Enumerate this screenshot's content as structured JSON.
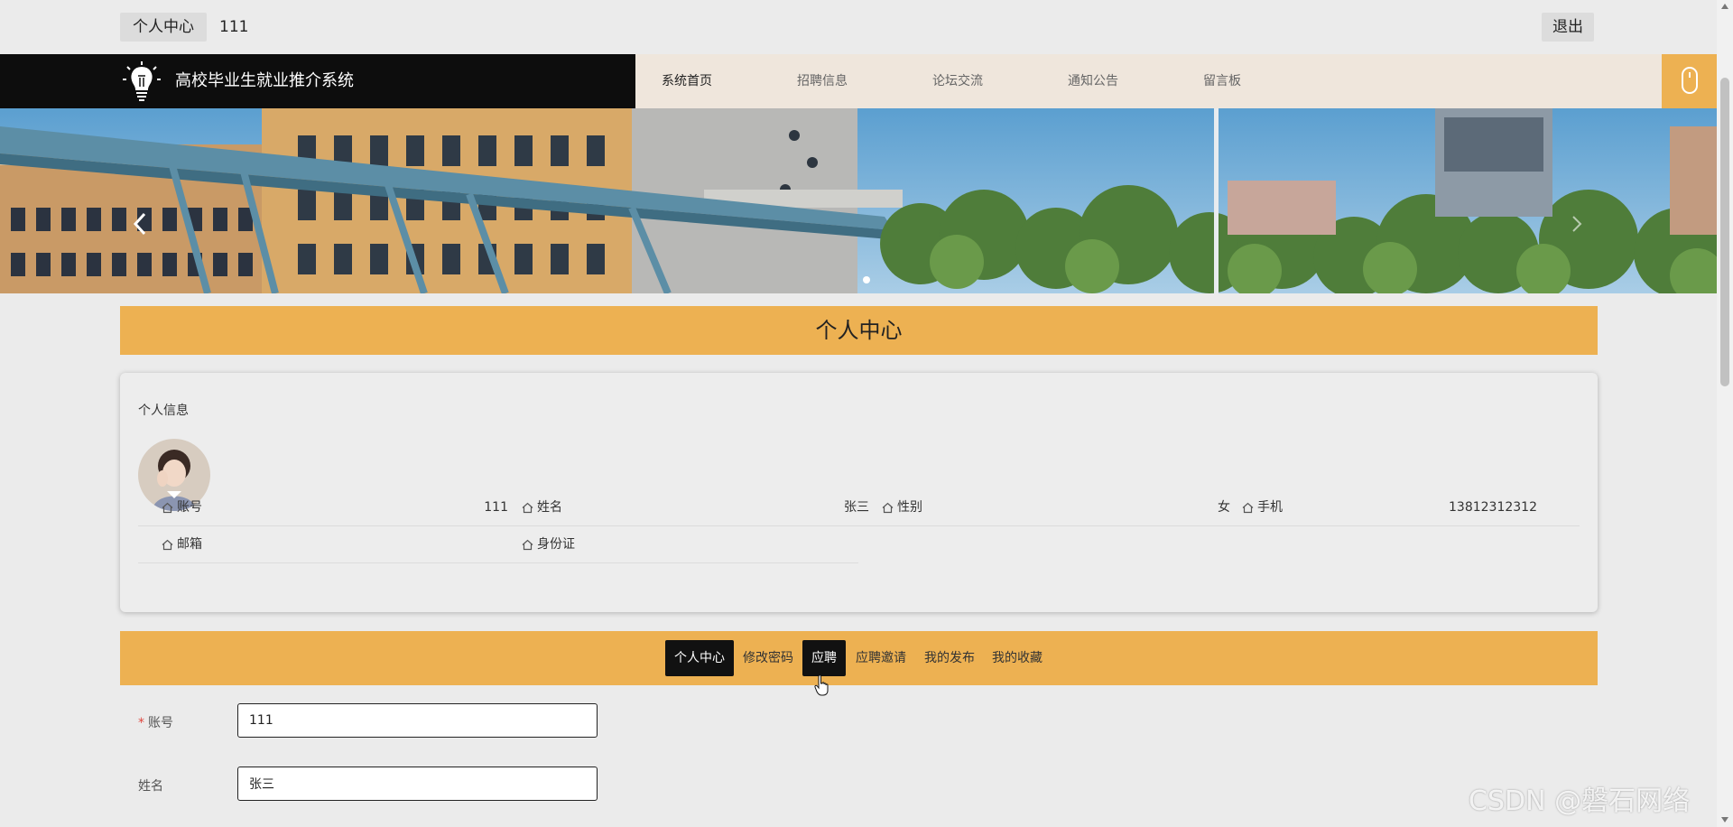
{
  "topbar": {
    "center_label": "个人中心",
    "username": "111",
    "logout_label": "退出"
  },
  "nav": {
    "brand_title": "高校毕业生就业推介系统",
    "items": [
      {
        "label": "系统首页"
      },
      {
        "label": "招聘信息"
      },
      {
        "label": "论坛交流"
      },
      {
        "label": "通知公告"
      },
      {
        "label": "留言板"
      }
    ],
    "accent_color": "#edb152"
  },
  "section_title": "个人中心",
  "profile": {
    "card_title": "个人信息",
    "fields": [
      {
        "label": "账号",
        "value": "111"
      },
      {
        "label": "姓名",
        "value": "张三"
      },
      {
        "label": "性别",
        "value": "女"
      },
      {
        "label": "手机",
        "value": "13812312312"
      },
      {
        "label": "邮箱",
        "value": ""
      },
      {
        "label": "身份证",
        "value": ""
      }
    ]
  },
  "tabs": [
    {
      "label": "个人中心"
    },
    {
      "label": "修改密码"
    },
    {
      "label": "应聘"
    },
    {
      "label": "应聘邀请"
    },
    {
      "label": "我的发布"
    },
    {
      "label": "我的收藏"
    }
  ],
  "form": {
    "account": {
      "label": "账号",
      "required_mark": "*",
      "value": "111"
    },
    "name": {
      "label": "姓名",
      "value": "张三"
    }
  },
  "watermark": "CSDN @磐石网络"
}
